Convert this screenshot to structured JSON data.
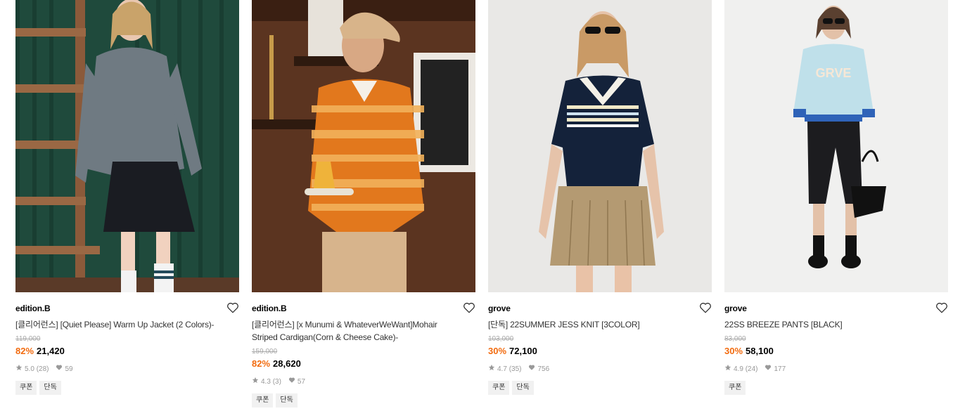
{
  "products": [
    {
      "brand": "edition.B",
      "title": "[클리어런스] [Quiet Please] Warm Up Jacket (2 Colors)-",
      "original_price": "119,000",
      "discount": "82%",
      "price": "21,420",
      "rating": "5.0",
      "review_count": "(28)",
      "likes": "59",
      "tags": [
        "쿠폰",
        "단독"
      ]
    },
    {
      "brand": "edition.B",
      "title": "[클리어런스] [x Munumi & WhateverWeWant]Mohair Striped Cardigan(Corn & Cheese Cake)-",
      "original_price": "159,000",
      "discount": "82%",
      "price": "28,620",
      "rating": "4.3",
      "review_count": "(3)",
      "likes": "57",
      "tags": [
        "쿠폰",
        "단독"
      ]
    },
    {
      "brand": "grove",
      "title": "[단독] 22SUMMER JESS KNIT [3COLOR]",
      "original_price": "103,000",
      "discount": "30%",
      "price": "72,100",
      "rating": "4.7",
      "review_count": "(35)",
      "likes": "756",
      "tags": [
        "쿠폰",
        "단독"
      ]
    },
    {
      "brand": "grove",
      "title": "22SS BREEZE PANTS [BLACK]",
      "original_price": "83,000",
      "discount": "30%",
      "price": "58,100",
      "rating": "4.9",
      "review_count": "(24)",
      "likes": "177",
      "tags": [
        "쿠폰"
      ]
    }
  ],
  "icons": {
    "like": "heart-outline-icon",
    "rating": "star-icon",
    "likes_count": "heart-filled-icon"
  },
  "colors": {
    "discount": "#f26b0f",
    "muted": "#999999"
  }
}
